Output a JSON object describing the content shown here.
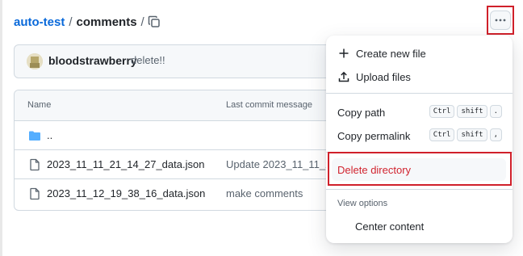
{
  "breadcrumb": {
    "repo": "auto-test",
    "separator": "/",
    "folder": "comments",
    "trailing_separator": "/"
  },
  "commit": {
    "author": "bloodstrawberry",
    "message": "delete!!"
  },
  "table": {
    "headers": {
      "name": "Name",
      "last_commit": "Last commit message"
    },
    "rows": [
      {
        "name": "..",
        "commit": "",
        "icon": "folder-icon"
      },
      {
        "name": "2023_11_11_21_14_27_data.json",
        "commit": "Update 2023_11_11_21",
        "icon": "file-icon"
      },
      {
        "name": "2023_11_12_19_38_16_data.json",
        "commit": "make comments",
        "icon": "file-icon"
      }
    ]
  },
  "menu": {
    "create_new_file": "Create new file",
    "upload_files": "Upload files",
    "copy_path": "Copy path",
    "copy_path_keys": [
      "Ctrl",
      "shift",
      "."
    ],
    "copy_permalink": "Copy permalink",
    "copy_permalink_keys": [
      "Ctrl",
      "shift",
      ","
    ],
    "delete_directory": "Delete directory",
    "view_options_label": "View options",
    "center_content": "Center content"
  },
  "colors": {
    "link": "#0969da",
    "danger": "#d1242f",
    "highlight_box": "#d0202a",
    "folder": "#54aeff"
  }
}
